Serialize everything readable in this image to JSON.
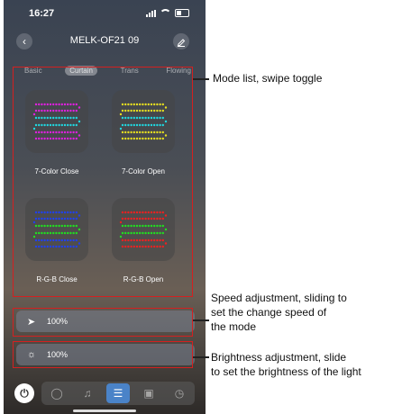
{
  "status": {
    "time": "16:27"
  },
  "header": {
    "title": "MELK-OF21  09"
  },
  "tabs": [
    {
      "label": "Basic",
      "active": false
    },
    {
      "label": "Curtain",
      "active": true
    },
    {
      "label": "Trans",
      "active": false
    },
    {
      "label": "Flowing",
      "active": false
    }
  ],
  "modes": [
    {
      "label": "7-Color Close",
      "colors": [
        "#e020e0",
        "#20d8e0",
        "#e020e0"
      ]
    },
    {
      "label": "7-Color Open",
      "colors": [
        "#e8e020",
        "#20d8e0",
        "#e8e020"
      ]
    },
    {
      "label": "R-G-B Close",
      "colors": [
        "#2040f0",
        "#20e020",
        "#2040f0"
      ]
    },
    {
      "label": "R-G-B Open",
      "colors": [
        "#f02020",
        "#20e020",
        "#f02020"
      ]
    }
  ],
  "speed": {
    "value": "100%",
    "icon": "rocket-icon"
  },
  "brightness": {
    "value": "100%",
    "icon": "sun-icon"
  },
  "nav": {
    "items": [
      "power-icon",
      "palette-icon",
      "music-icon",
      "sliders-icon",
      "film-icon",
      "clock-icon"
    ],
    "active": "sliders-icon",
    "accent": "#4a83c8"
  },
  "annotations": {
    "mode": "Mode list, swipe toggle",
    "speed_line1": "Speed adjustment, sliding to",
    "speed_line2": "set the change speed of",
    "speed_line3": "the mode",
    "bright_line1": "Brightness adjustment, slide",
    "bright_line2": "to set the brightness of the light"
  },
  "highlight_color": "#d42020"
}
